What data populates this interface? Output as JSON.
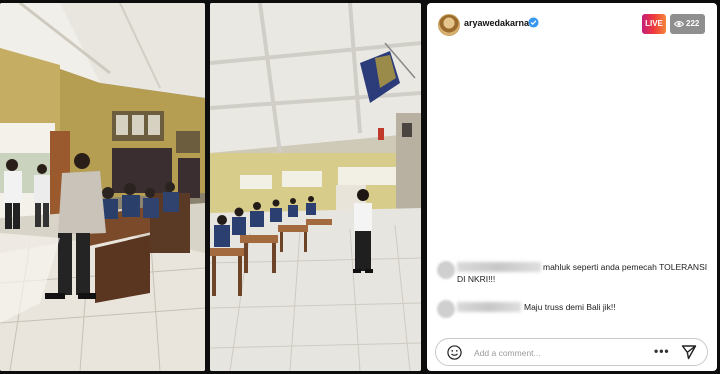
{
  "live_panel": {
    "username": "aryawedakarna",
    "live_badge": "LIVE",
    "viewer_count": "222",
    "comments": [
      {
        "line1": "mahluk seperti anda pemecah TOLERANSI",
        "line2": "DI NKRI!!!"
      },
      {
        "line1": "Maju truss demi Bali jik!!"
      }
    ],
    "composer": {
      "placeholder": "Add a comment..."
    }
  },
  "icons": {
    "verified": "verified-badge-icon",
    "viewers": "eye-icon",
    "emoji": "smiley-icon",
    "more": "more-options-icon",
    "send": "send-paper-plane-icon"
  },
  "colors": {
    "live_gradient_start": "#c41e7a",
    "live_gradient_end": "#f5873b",
    "viewer_badge": "#8f8f8f",
    "verified": "#3897f0"
  }
}
